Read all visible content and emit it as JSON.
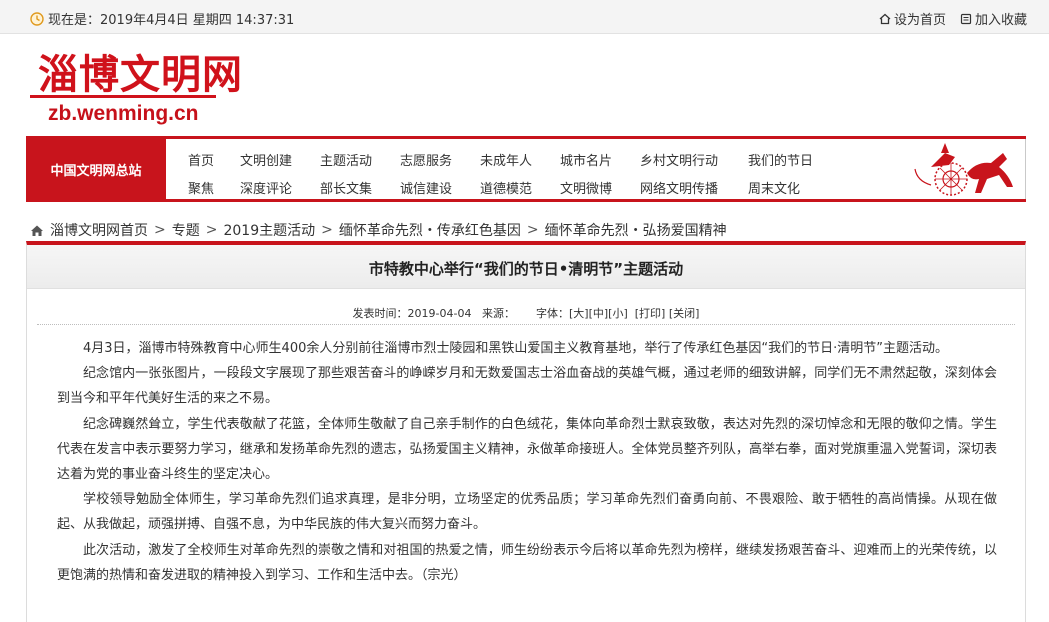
{
  "topbar": {
    "date_label": "现在是：2019年4月4日 星期四 14:37:31",
    "set_home": "设为首页",
    "add_favorite": "加入收藏"
  },
  "logo": {
    "cn": "淄博文明网",
    "en": "zb.wenming.cn"
  },
  "nav": {
    "site": "中国文明网总站",
    "row1": [
      "首页",
      "文明创建",
      "主题活动",
      "志愿服务",
      "未成年人",
      "城市名片",
      "乡村文明行动",
      "我们的节日"
    ],
    "row2": [
      "聚焦",
      "深度评论",
      "部长文集",
      "诚信建设",
      "道德模范",
      "文明微博",
      "网络文明传播",
      "周末文化"
    ]
  },
  "breadcrumb": [
    "淄博文明网首页",
    "专题",
    "2019主题活动",
    "缅怀革命先烈・传承红色基因",
    "缅怀革命先烈・弘扬爱国精神"
  ],
  "article": {
    "title": "市特教中心举行“我们的节日•清明节”主题活动",
    "meta": {
      "publish_label": "发表时间：",
      "publish_date": "2019-04-04",
      "source_label": "来源：",
      "font_label": "字体：",
      "font_large": "[大]",
      "font_medium": "[中]",
      "font_small": "[小]",
      "print": "[打印]",
      "close": "[关闭]"
    },
    "paragraphs": [
      "4月3日，淄博市特殊教育中心师生400余人分别前往淄博市烈士陵园和黑铁山爱国主义教育基地，举行了传承红色基因“我们的节日·清明节”主题活动。",
      "纪念馆内一张张图片，一段段文字展现了那些艰苦奋斗的峥嵘岁月和无数爱国志士浴血奋战的英雄气概，通过老师的细致讲解，同学们无不肃然起敬，深刻体会到当今和平年代美好生活的来之不易。",
      "纪念碑巍然耸立，学生代表敬献了花篮，全体师生敬献了自己亲手制作的白色绒花，集体向革命烈士默哀致敬，表达对先烈的深切悼念和无限的敬仰之情。学生代表在发言中表示要努力学习，继承和发扬革命先烈的遗志，弘扬爱国主义精神，永做革命接班人。全体党员整齐列队，高举右拳，面对党旗重温入党誓词，深切表达着为党的事业奋斗终生的坚定决心。",
      "学校领导勉励全体师生，学习革命先烈们追求真理，是非分明，立场坚定的优秀品质；学习革命先烈们奋勇向前、不畏艰险、敢于牺牲的高尚情操。从现在做起、从我做起，顽强拼搏、自强不息，为中华民族的伟大复兴而努力奋斗。",
      "此次活动，激发了全校师生对革命先烈的崇敬之情和对祖国的热爱之情，师生纷纷表示今后将以革命先烈为榜样，继续发扬艰苦奋斗、迎难而上的光荣传统，以更饱满的热情和奋发进取的精神投入到学习、工作和生活中去。（宗光）"
    ]
  },
  "icons": {
    "clock": "clock-icon",
    "home": "home-icon",
    "favorite": "bookmark-icon"
  },
  "colors": {
    "brand_red": "#c8141c"
  }
}
